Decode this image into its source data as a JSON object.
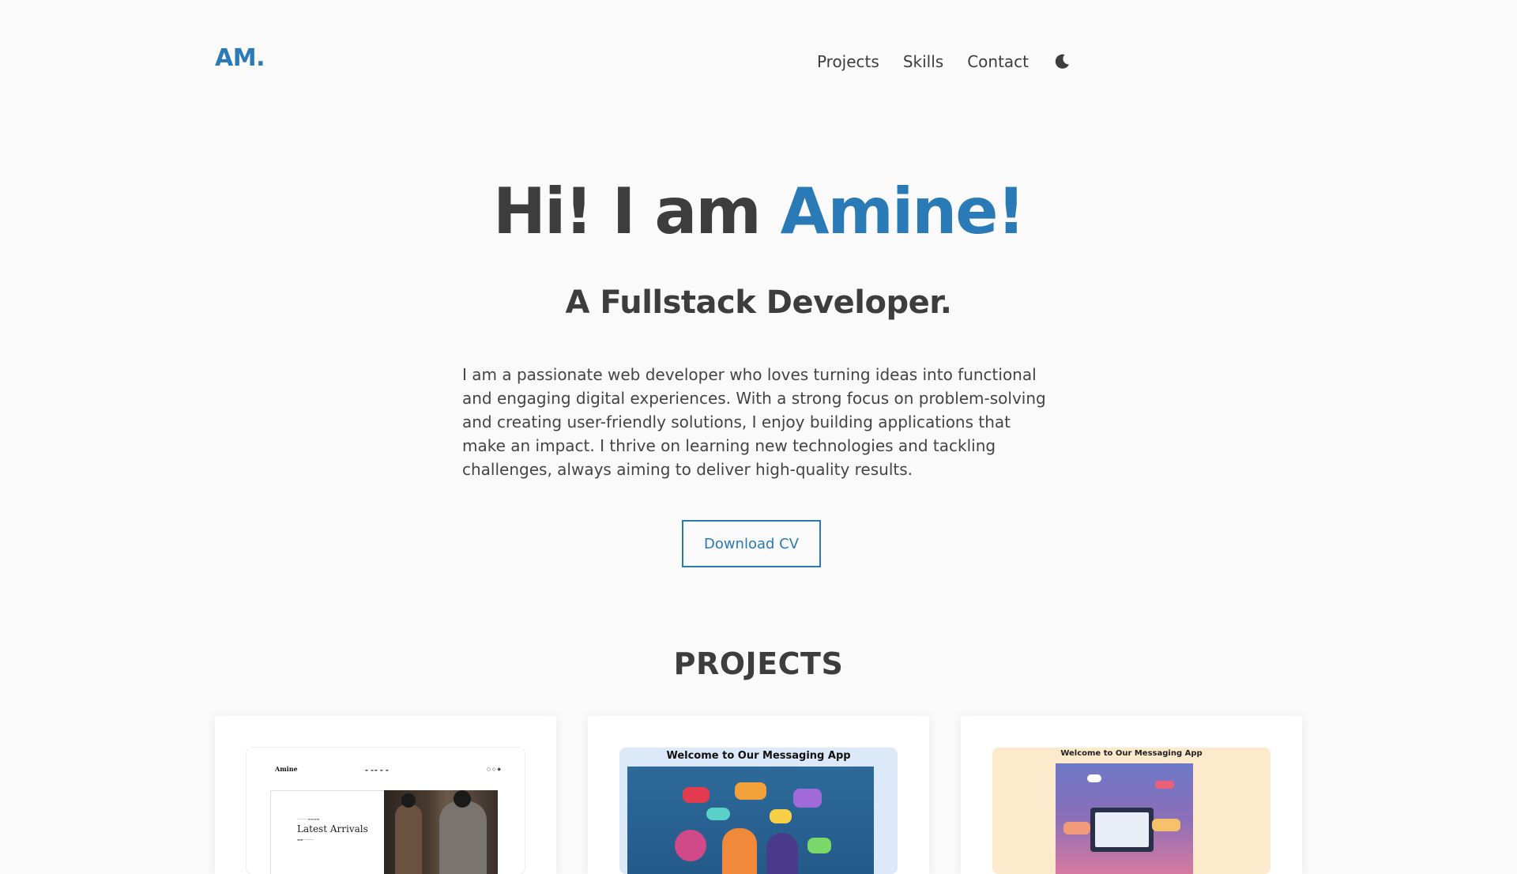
{
  "header": {
    "logo": "AM.",
    "nav": [
      "Projects",
      "Skills",
      "Contact"
    ],
    "theme_toggle_icon": "moon-icon"
  },
  "hero": {
    "greeting": "Hi! I am ",
    "name": "Amine!",
    "subtitle": "A Fullstack Developer.",
    "description": "I am a passionate web developer who loves turning ideas into functional and engaging digital experiences. With a strong focus on problem-solving and creating user-friendly solutions, I enjoy building applications that make an impact. I thrive on learning new technologies and tackling challenges, always aiming to deliver high-quality results.",
    "cv_button": "Download CV"
  },
  "projects": {
    "title": "PROJECTS",
    "cards": [
      {
        "thumb_brand": "Amine",
        "thumb_heading": "Latest Arrivals"
      },
      {
        "thumb_caption": "Welcome to Our Messaging App"
      },
      {
        "thumb_caption": "Welcome to Our Messaging App"
      }
    ]
  },
  "colors": {
    "accent": "#2a7ab8",
    "text": "#3d3d3d",
    "background": "#fafafa"
  }
}
